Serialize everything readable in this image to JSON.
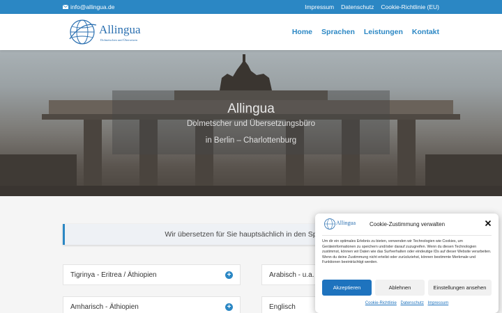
{
  "topbar": {
    "email": "info@allingua.de",
    "links": [
      "Impressum",
      "Datenschutz",
      "Cookie-Richtlinie (EU)"
    ]
  },
  "header": {
    "logo_text": "Allingua",
    "logo_tagline": "Dolmetschen und Übersetzen",
    "nav": [
      "Home",
      "Sprachen",
      "Leistungen",
      "Kontakt"
    ]
  },
  "hero": {
    "title": "Allingua",
    "subtitle": "Dolmetscher und Übersetzungsbüro",
    "location": "in Berlin – Charlottenburg"
  },
  "content": {
    "banner": "Wir übersetzen für Sie hauptsächlich in den Sprachen:",
    "accordion_left": [
      "Tigrinya - Eritrea / Äthiopien",
      "Amharisch - Äthiopien"
    ],
    "accordion_right": [
      "Arabisch - u.a. Ägypten",
      "Englisch"
    ]
  },
  "cookie": {
    "logo_text": "Allingua",
    "title": "Cookie-Zustimmung verwalten",
    "text": "Um dir ein optimales Erlebnis zu bieten, verwenden wir Technologien wie Cookies, um Geräteinformationen zu speichern und/oder darauf zuzugreifen. Wenn du diesen Technologien zustimmst, können wir Daten wie das Surfverhalten oder eindeutige IDs auf dieser Website verarbeiten. Wenn du deine Zustimmung nicht erteilst oder zurückziehst, können bestimmte Merkmale und Funktionen beeinträchtigt werden.",
    "accept": "Akzeptieren",
    "deny": "Ablehnen",
    "preferences": "Einstellungen ansehen",
    "footer_links": [
      "Cookie-Richtlinie",
      "Datenschutz",
      "Impressum"
    ]
  },
  "colors": {
    "brand_blue": "#2b87c4",
    "button_blue": "#1e73be"
  }
}
